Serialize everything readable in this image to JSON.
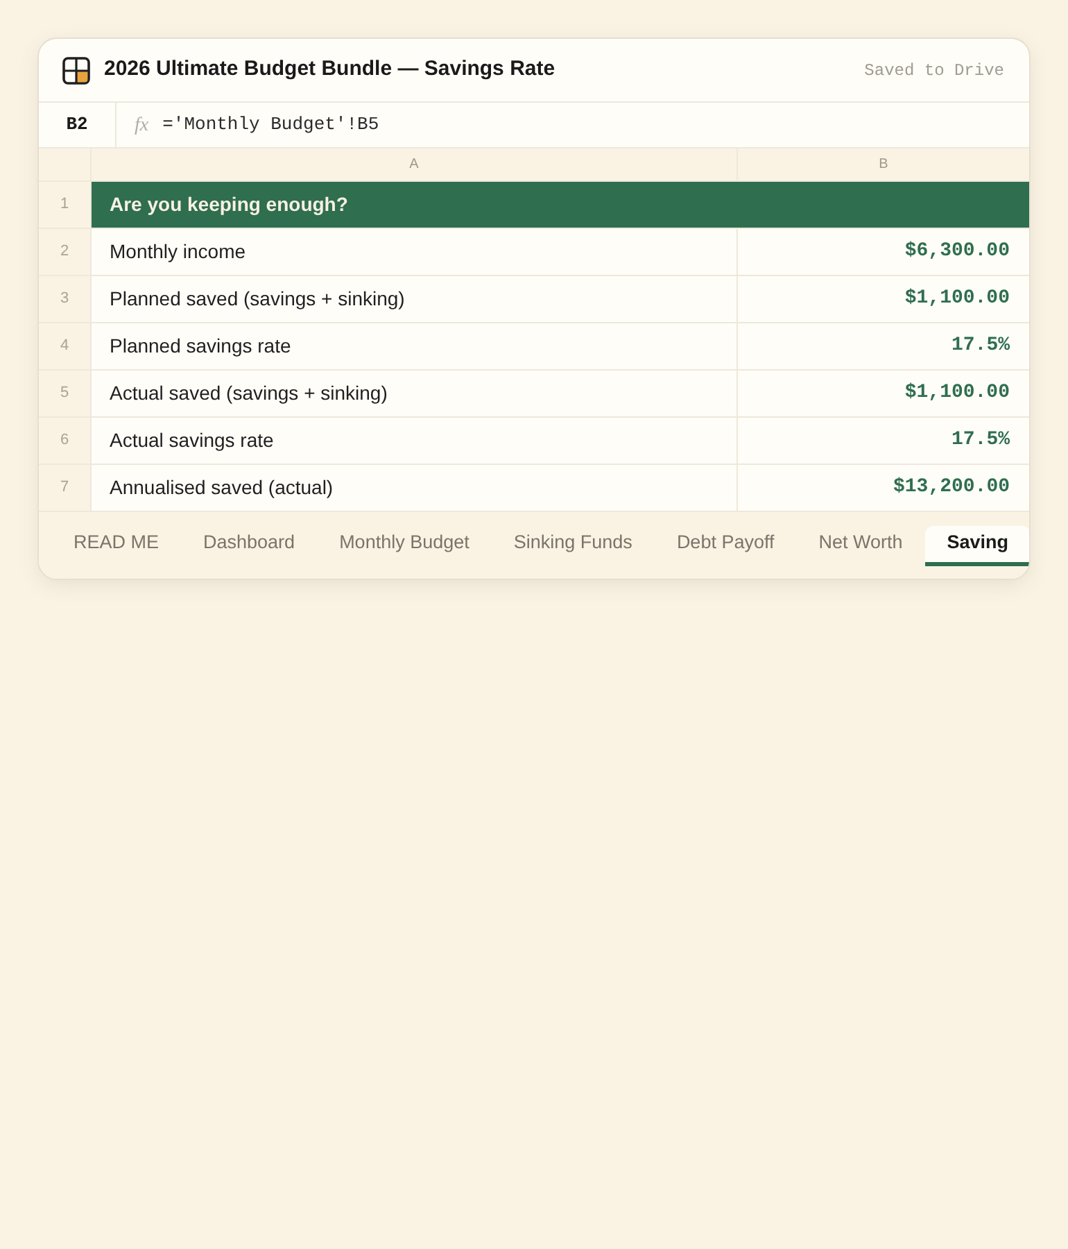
{
  "window": {
    "title": "2026 Ultimate Budget Bundle — Savings Rate",
    "status": "Saved to Drive"
  },
  "formula_bar": {
    "cell": "B2",
    "fx": "fx",
    "formula": "='Monthly Budget'!B5"
  },
  "sheet": {
    "columns": [
      "A",
      "B"
    ],
    "rows": [
      {
        "number": "1",
        "kind": "heading",
        "label": "Are you keeping enough?"
      },
      {
        "number": "2",
        "kind": "value",
        "label": "Monthly income",
        "value": "$6,300.00"
      },
      {
        "number": "3",
        "kind": "value",
        "label": "Planned saved (savings + sinking)",
        "value": "$1,100.00"
      },
      {
        "number": "4",
        "kind": "value",
        "label": "Planned savings rate",
        "value": "17.5%"
      },
      {
        "number": "5",
        "kind": "value",
        "label": "Actual saved (savings + sinking)",
        "value": "$1,100.00"
      },
      {
        "number": "6",
        "kind": "value",
        "label": "Actual savings rate",
        "value": "17.5%"
      },
      {
        "number": "7",
        "kind": "value",
        "label": "Annualised saved (actual)",
        "value": "$13,200.00"
      }
    ]
  },
  "tabs": [
    {
      "label": "READ ME",
      "selected": false
    },
    {
      "label": "Dashboard",
      "selected": false
    },
    {
      "label": "Monthly Budget",
      "selected": false
    },
    {
      "label": "Sinking Funds",
      "selected": false
    },
    {
      "label": "Debt Payoff",
      "selected": false
    },
    {
      "label": "Net Worth",
      "selected": false
    },
    {
      "label": "Saving",
      "selected": true
    }
  ]
}
